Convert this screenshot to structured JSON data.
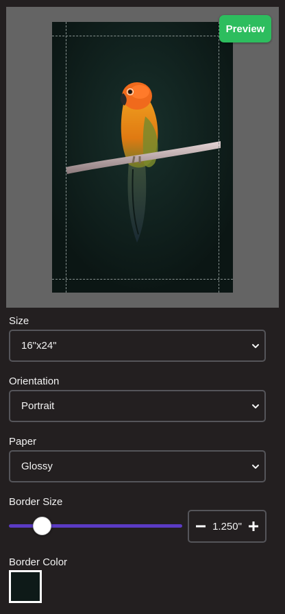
{
  "preview": {
    "button_label": "Preview",
    "button_color": "#2dbd5e",
    "image_alt": "parrot-on-branch-photo"
  },
  "fields": {
    "size": {
      "label": "Size",
      "value": "16\"x24\""
    },
    "orientation": {
      "label": "Orientation",
      "value": "Portrait"
    },
    "paper": {
      "label": "Paper",
      "value": "Glossy"
    }
  },
  "border_size": {
    "label": "Border Size",
    "value": "1.250\"",
    "slider_fraction": 0.19,
    "accent": "#5b3bc4"
  },
  "border_color": {
    "label": "Border Color",
    "swatch": "#0e1a18"
  },
  "icons": {
    "minus": "minus-icon",
    "plus": "plus-icon",
    "chevron": "chevron-down-icon"
  }
}
